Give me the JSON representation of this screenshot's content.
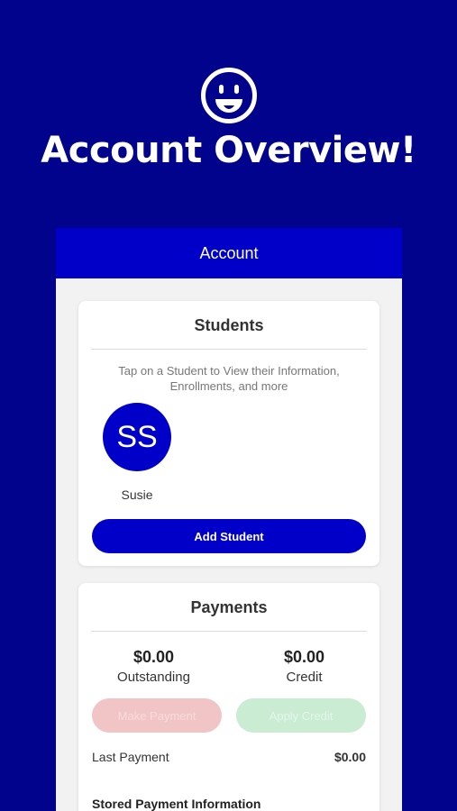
{
  "hero": {
    "icon": "smiley-face-icon",
    "title": "Account Overview!"
  },
  "header": {
    "title": "Account"
  },
  "students": {
    "title": "Students",
    "hint": "Tap on a Student to View their Information, Enrollments, and more",
    "items": [
      {
        "initials": "SS",
        "name": "Susie"
      }
    ],
    "add_label": "Add Student"
  },
  "payments": {
    "title": "Payments",
    "outstanding_value": "$0.00",
    "outstanding_label": "Outstanding",
    "credit_value": "$0.00",
    "credit_label": "Credit",
    "make_payment_label": "Make Payment",
    "apply_credit_label": "Apply Credit",
    "last_payment_label": "Last Payment",
    "last_payment_value": "$0.00",
    "stored_label": "Stored Payment Information"
  },
  "colors": {
    "background": "#01038c",
    "accent": "#0000c8",
    "make_payment_disabled": "#f1c5c5",
    "apply_credit_disabled": "#c9ecd3"
  }
}
